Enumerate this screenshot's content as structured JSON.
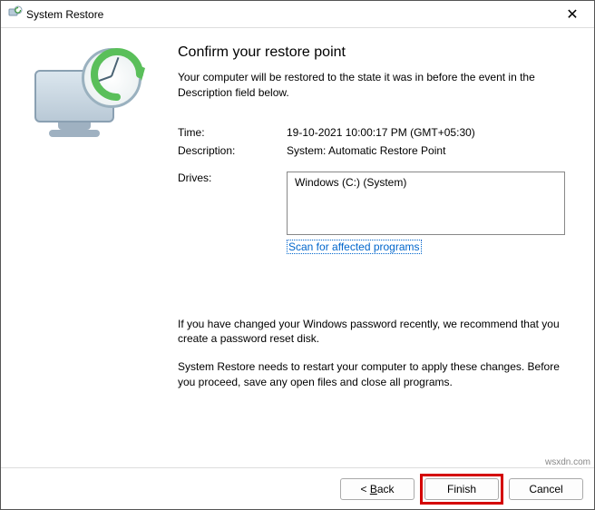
{
  "window": {
    "title": "System Restore",
    "close": "✕"
  },
  "heading": "Confirm your restore point",
  "subtitle": "Your computer will be restored to the state it was in before the event in the Description field below.",
  "details": {
    "time_label": "Time:",
    "time_value": "19-10-2021 10:00:17 PM (GMT+05:30)",
    "desc_label": "Description:",
    "desc_value": "System: Automatic Restore Point",
    "drives_label": "Drives:",
    "drives_value": "Windows (C:) (System)"
  },
  "scan_link": "Scan for affected programs",
  "warnings": {
    "password": "If you have changed your Windows password recently, we recommend that you create a password reset disk.",
    "restart": "System Restore needs to restart your computer to apply these changes. Before you proceed, save any open files and close all programs."
  },
  "buttons": {
    "back_prefix": "< ",
    "back_accel": "B",
    "back_suffix": "ack",
    "finish": "Finish",
    "cancel": "Cancel"
  },
  "watermark": "wsxdn.com"
}
